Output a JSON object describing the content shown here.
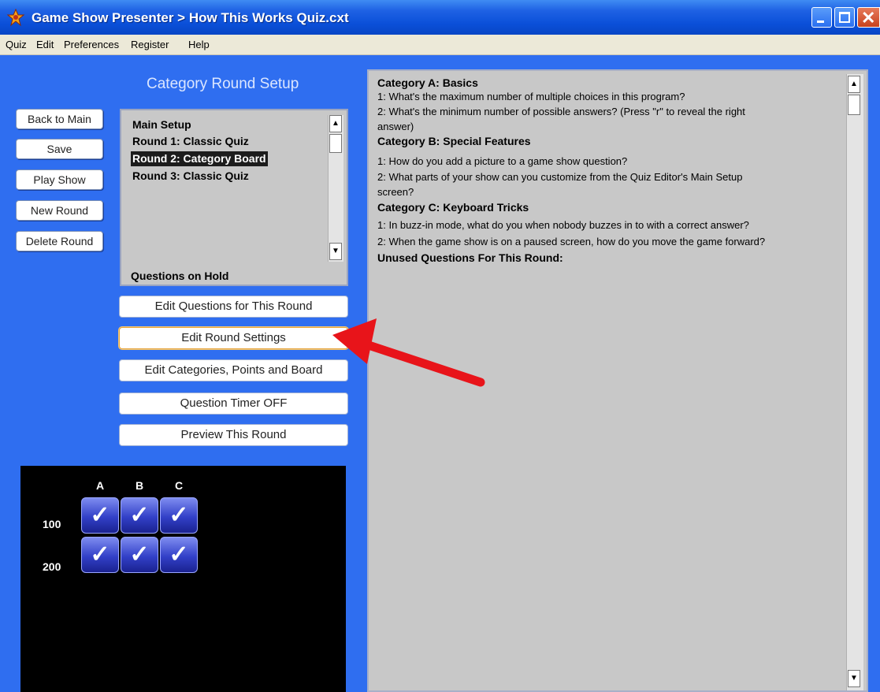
{
  "window": {
    "title": "Game Show Presenter  > How This Works Quiz.cxt"
  },
  "menu": [
    "Quiz",
    "Edit",
    "Preferences",
    "Register",
    "Help"
  ],
  "setup": {
    "title": "Category Round Setup",
    "side_buttons": [
      "Back to Main",
      "Save",
      "Play Show",
      "New Round",
      "Delete Round"
    ],
    "rounds": [
      {
        "label": "Main Setup",
        "selected": false
      },
      {
        "label": "Round 1: Classic Quiz",
        "selected": false
      },
      {
        "label": "Round 2: Category Board",
        "selected": true
      },
      {
        "label": "Round 3: Classic Quiz",
        "selected": false
      }
    ],
    "hold_label": "Questions on Hold",
    "action_buttons": [
      {
        "label": "Edit Questions for This Round",
        "active": false
      },
      {
        "label": "Edit Round Settings",
        "active": true
      },
      {
        "label": "Edit Categories, Points and Board",
        "active": false
      },
      {
        "label": "Question Timer OFF",
        "active": false
      },
      {
        "label": "Preview This Round",
        "active": false
      }
    ]
  },
  "board": {
    "categories": [
      "A",
      "B",
      "C"
    ],
    "points": [
      "100",
      "200"
    ],
    "tile_glyph": "✓"
  },
  "questions": {
    "lines": [
      {
        "text": "Category A: Basics",
        "kind": "cat"
      },
      {
        "text": "1:  What's the maximum number of multiple choices in this program?",
        "kind": "q"
      },
      {
        "text": "2:  What's the minimum number of possible answers? (Press \"r\" to reveal the right",
        "kind": "q"
      },
      {
        "text": "answer)",
        "kind": "q"
      },
      {
        "text": "Category B: Special Features",
        "kind": "cat"
      },
      {
        "text": "1:  How do you add a picture to a game show question?",
        "kind": "q"
      },
      {
        "text": "2:  What parts of your show can you customize from the Quiz Editor's Main Setup",
        "kind": "q"
      },
      {
        "text": "screen?",
        "kind": "q"
      },
      {
        "text": "Category C: Keyboard Tricks",
        "kind": "cat"
      },
      {
        "text": "1:  In buzz-in mode, what do you when nobody buzzes in to with a correct answer?",
        "kind": "q"
      },
      {
        "text": "2:  When the game show is on a paused screen, how do you move the game forward?",
        "kind": "q"
      },
      {
        "text": "Unused Questions For This Round:",
        "kind": "cat"
      }
    ]
  },
  "colors": {
    "background": "#2f6ef0",
    "annotation_arrow": "#e8141a"
  }
}
